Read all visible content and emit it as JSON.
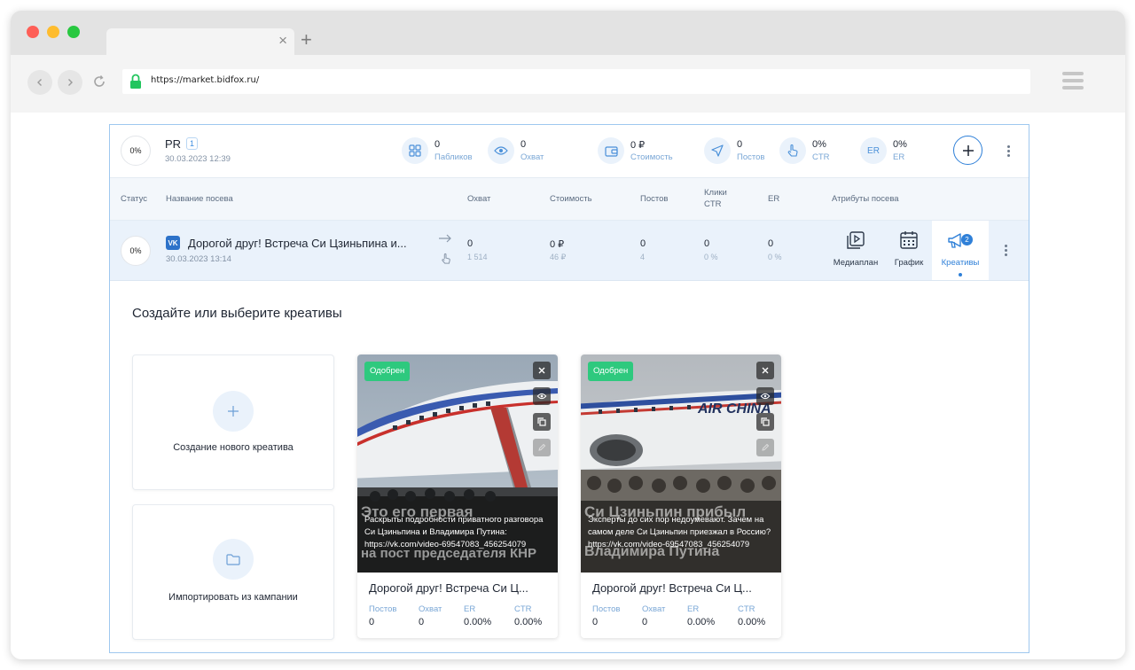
{
  "browser": {
    "url": "https://market.bidfox.ru/",
    "tab_close": "×",
    "tab_new": "+"
  },
  "header": {
    "progress": "0%",
    "title": "PR",
    "badge": "1",
    "date": "30.03.2023 12:39",
    "stats": [
      {
        "icon": "grid-icon",
        "value": "0",
        "label": "Пабликов"
      },
      {
        "icon": "eye-icon",
        "value": "0",
        "label": "Охват"
      },
      {
        "icon": "wallet-icon",
        "value": "0 ₽",
        "label": "Стоимость"
      },
      {
        "icon": "send-icon",
        "value": "0",
        "label": "Постов"
      },
      {
        "icon": "pointer-icon",
        "value": "0%",
        "label": "CTR"
      },
      {
        "icon": "er-icon",
        "icon_text": "ER",
        "value": "0%",
        "label": "ER"
      }
    ]
  },
  "columns": {
    "status": "Статус",
    "name": "Название посева",
    "reach": "Охват",
    "cost": "Стоимость",
    "posts": "Постов",
    "clicks_line1": "Клики",
    "clicks_line2": "CTR",
    "er": "ER",
    "attributes": "Атрибуты посева"
  },
  "row": {
    "progress": "0%",
    "network": "VK",
    "title": "Дорогой друг! Встреча Си Цзиньпина и...",
    "date": "30.03.2023 13:14",
    "reach": "0",
    "reach_sub": "1 514",
    "cost": "0 ₽",
    "cost_sub": "46 ₽",
    "posts": "0",
    "posts_sub": "4",
    "clicks": "0",
    "clicks_sub": "0 %",
    "er": "0",
    "er_sub": "0 %",
    "attributes": [
      {
        "icon": "media-plan-icon",
        "label": "Медиаплан"
      },
      {
        "icon": "calendar-icon",
        "label": "График"
      },
      {
        "icon": "megaphone-icon",
        "label": "Креативы",
        "count": "2",
        "active": true
      }
    ]
  },
  "section": {
    "title": "Создайте или выберите креативы",
    "create_label": "Создание нового креатива",
    "import_label": "Импортировать из кампании"
  },
  "creatives": [
    {
      "status": "Одобрен",
      "image_text_line1": "Это его первая",
      "image_text_line2": "на пост председателя КНР",
      "caption": "Раскрыты подробности приватного разговора Си Цзиньпина и Владимира Путина: https://vk.com/video-69547083_456254079",
      "title": "Дорогой друг! Встреча Си Ц...",
      "stats": [
        {
          "label": "Постов",
          "value": "0"
        },
        {
          "label": "Охват",
          "value": "0"
        },
        {
          "label": "ER",
          "value": "0.00%"
        },
        {
          "label": "CTR",
          "value": "0.00%"
        }
      ]
    },
    {
      "status": "Одобрен",
      "image_text_line1": "Си Цзиньпин прибыл",
      "image_text_line2": "Владимира Путина",
      "caption": "Эксперты до сих пор недоумевают. Зачем на самом деле Си Цзиньпин приезжал в Россию? https://vk.com/video-69547083_456254079",
      "title": "Дорогой друг! Встреча Си Ц...",
      "stats": [
        {
          "label": "Постов",
          "value": "0"
        },
        {
          "label": "Охват",
          "value": "0"
        },
        {
          "label": "ER",
          "value": "0.00%"
        },
        {
          "label": "CTR",
          "value": "0.00%"
        }
      ]
    }
  ],
  "colors": {
    "accent": "#2f80d8",
    "approved": "#2ec97e",
    "panel_border": "#9fc8ef"
  }
}
